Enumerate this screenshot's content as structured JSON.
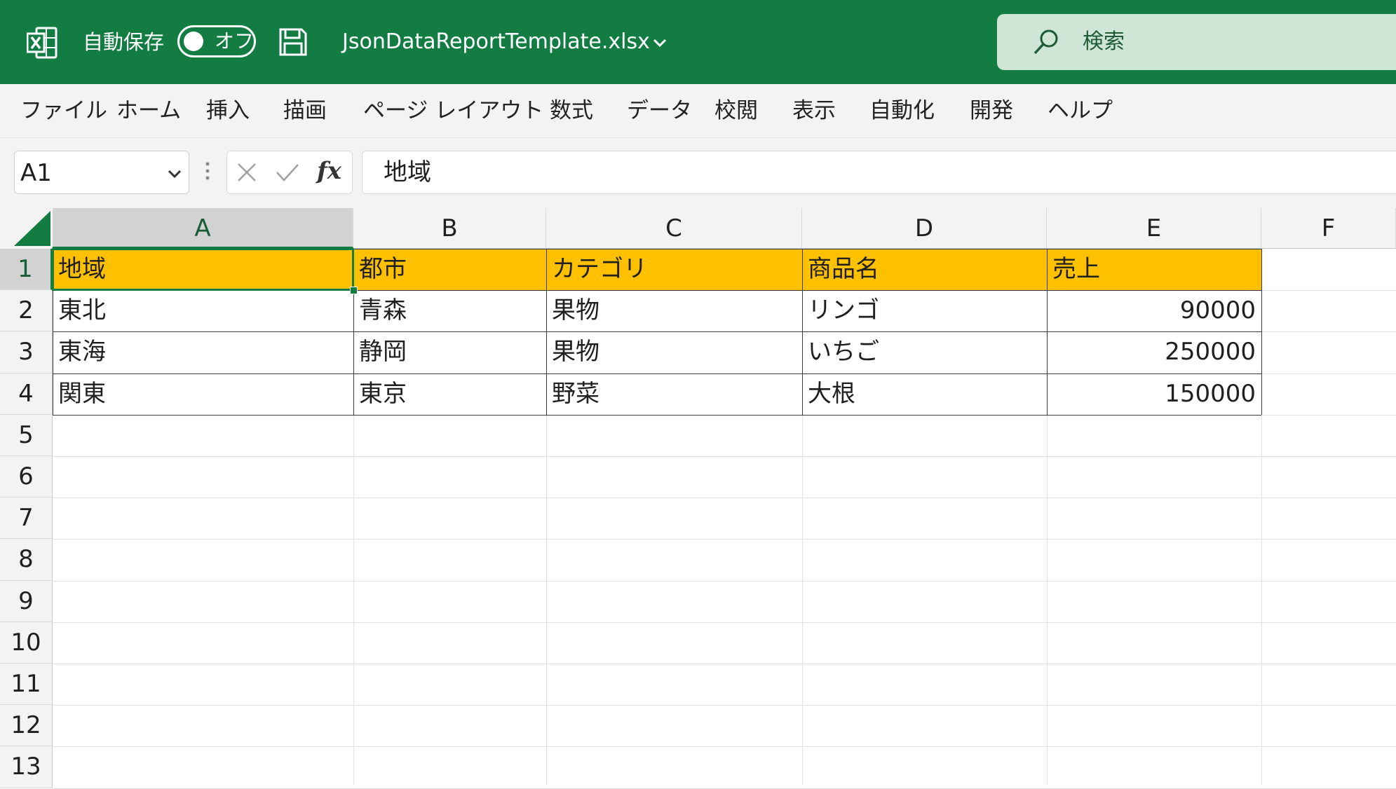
{
  "titlebar": {
    "app_icon": "excel-icon",
    "autosave_label": "自動保存",
    "autosave_state": "オフ",
    "save_icon": "save-icon",
    "filename": "JsonDataReportTemplate.xlsx",
    "search_placeholder": "検索",
    "background_color": "#137c43"
  },
  "menu": {
    "items": [
      "ファイル",
      "ホーム",
      "挿入",
      "描画",
      "ページ レイアウト",
      "数式",
      "データ",
      "校閲",
      "表示",
      "自動化",
      "開発",
      "ヘルプ"
    ]
  },
  "formula_bar": {
    "name_box": "A1",
    "fx_label": "fx",
    "formula": "地域"
  },
  "sheet": {
    "columns": [
      "A",
      "B",
      "C",
      "D",
      "E",
      "F"
    ],
    "rows": [
      "1",
      "2",
      "3",
      "4",
      "5",
      "6",
      "7",
      "8",
      "9",
      "10",
      "11",
      "12",
      "13"
    ],
    "selected_cell": "A1",
    "header_fill_color": "#ffc000",
    "cells": [
      [
        "地域",
        "都市",
        "カテゴリ",
        "商品名",
        "売上"
      ],
      [
        "東北",
        "青森",
        "果物",
        "リンゴ",
        "90000"
      ],
      [
        "東海",
        "静岡",
        "果物",
        "いちご",
        "250000"
      ],
      [
        "関東",
        "東京",
        "野菜",
        "大根",
        "150000"
      ]
    ]
  }
}
